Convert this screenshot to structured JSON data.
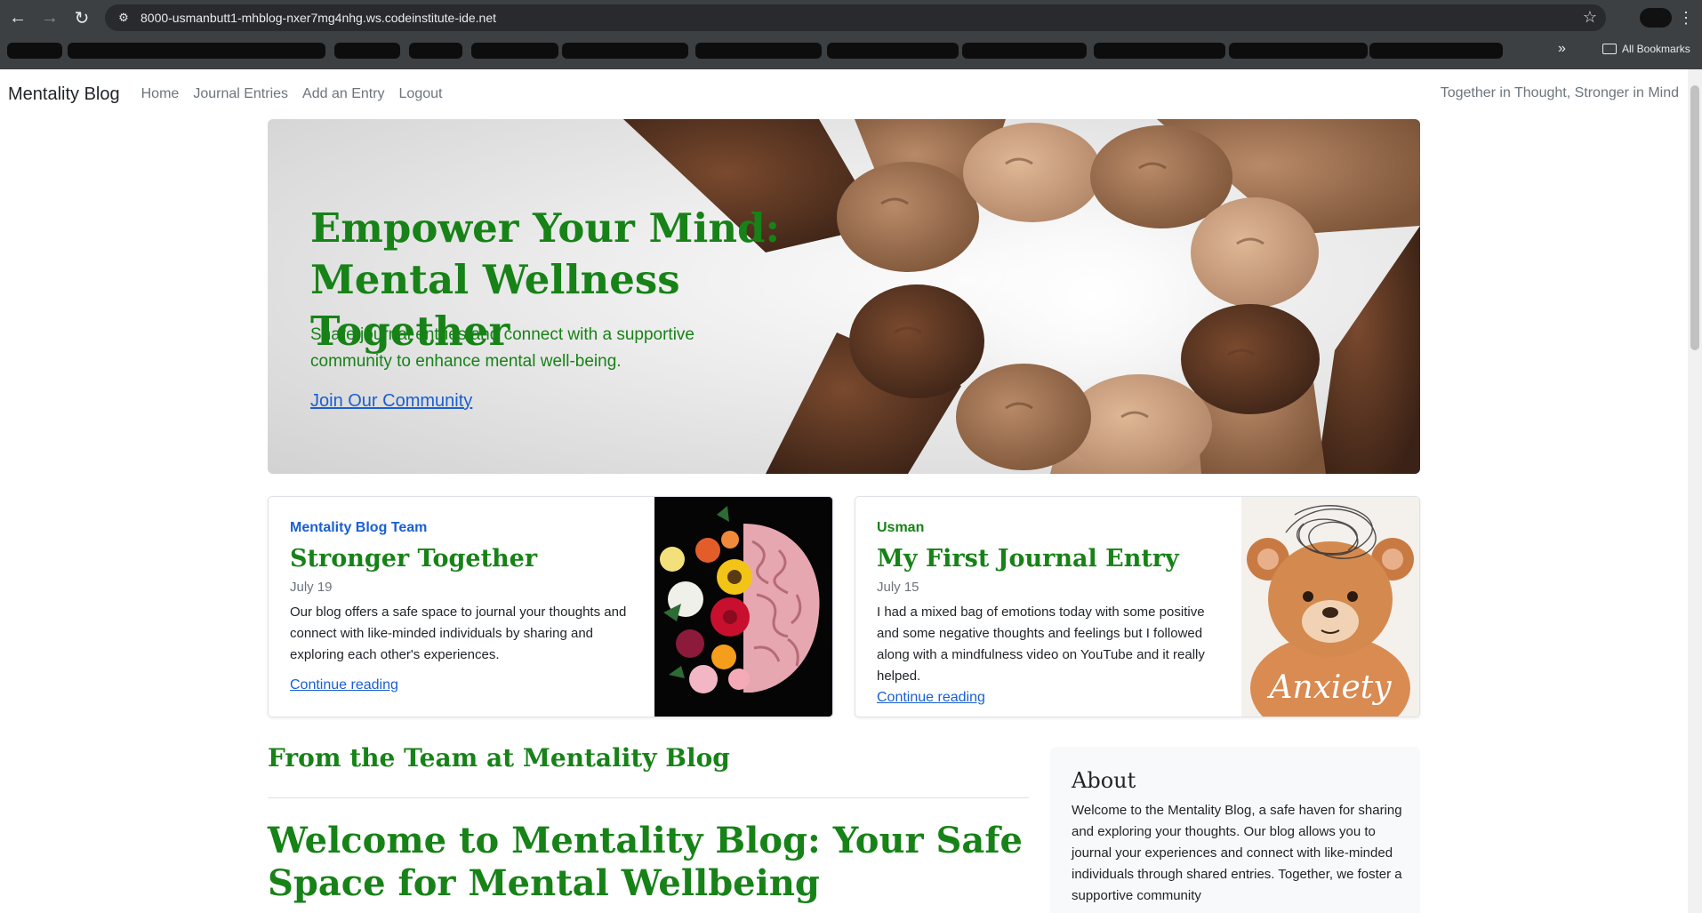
{
  "browser": {
    "url": "8000-usmanbutt1-mhblog-nxer7mg4nhg.ws.codeinstitute-ide.net",
    "all_bookmarks_label": "All Bookmarks"
  },
  "nav": {
    "brand": "Mentality Blog",
    "links": [
      "Home",
      "Journal Entries",
      "Add an Entry",
      "Logout"
    ],
    "tagline": "Together in Thought, Stronger in Mind"
  },
  "hero": {
    "title": "Empower Your Mind: Mental Wellness Together",
    "subtitle": "Share journal entries and connect with a supportive community to enhance mental well-being.",
    "cta": "Join Our Community"
  },
  "cards": [
    {
      "author": "Mentality Blog Team",
      "author_color": "#1a5fd1",
      "title": "Stronger Together",
      "date": "July 19",
      "excerpt": "Our blog offers a safe space to journal your thoughts and connect with like-minded individuals by sharing and exploring each other's experiences.",
      "link": "Continue reading"
    },
    {
      "author": "Usman",
      "author_color": "#178217",
      "title": "My First Journal Entry",
      "date": "July 15",
      "excerpt": "I had a mixed bag of emotions today with some positive and some negative thoughts and feelings but I followed along with a mindfulness video on YouTube and it really helped.",
      "link": "Continue reading",
      "image_caption": "Anxiety"
    }
  ],
  "featured": {
    "section_title": "From the Team at Mentality Blog",
    "post_title": "Welcome to Mentality Blog: Your Safe Space for Mental Wellbeing"
  },
  "about": {
    "heading": "About",
    "text": "Welcome to the Mentality Blog, a safe haven for sharing and exploring your thoughts. Our blog allows you to journal your experiences and connect with like-minded individuals through shared entries. Together, we foster a supportive community"
  },
  "colors": {
    "brand_green": "#178217",
    "link_blue": "#1a5fd1",
    "muted": "#6c757d"
  }
}
